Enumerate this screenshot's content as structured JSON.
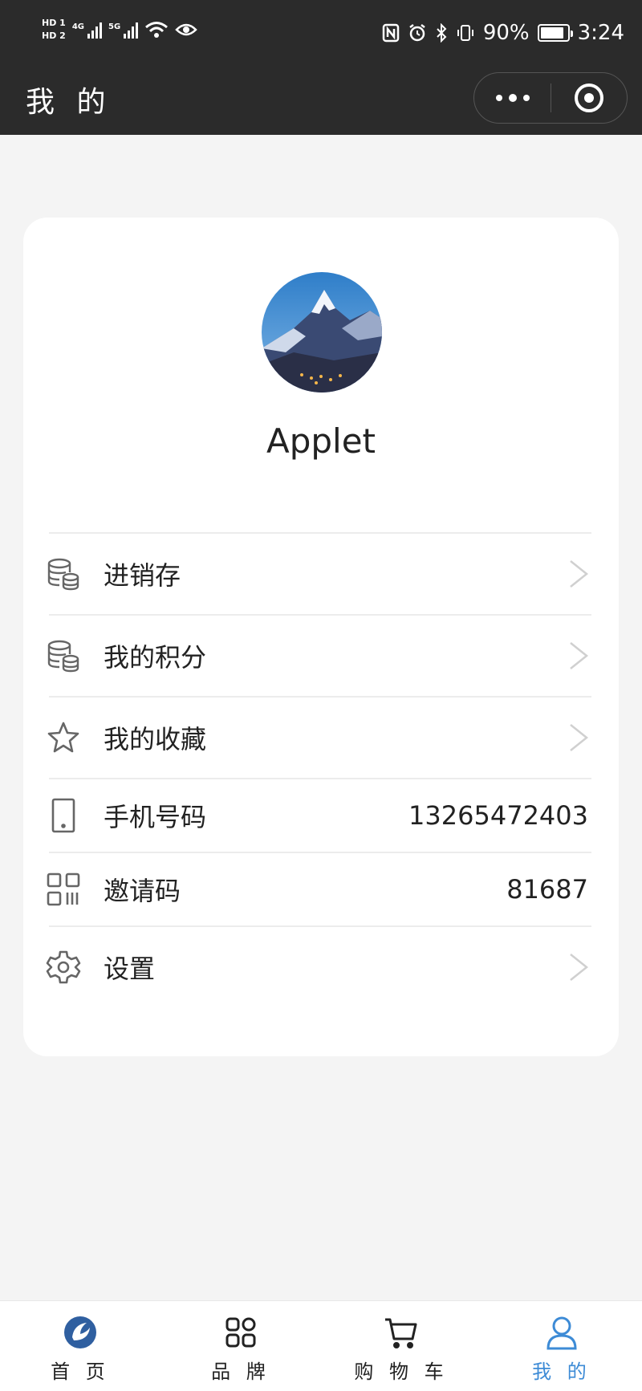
{
  "status_bar": {
    "hd1": "HD 1",
    "hd2": "HD 2",
    "net1": "4G",
    "net2": "5G",
    "battery_text": "90%",
    "battery_level": 0.9,
    "time": "3:24"
  },
  "header": {
    "title": "我 的",
    "more_icon": "more-dots-icon",
    "close_icon": "target-close-icon"
  },
  "profile": {
    "avatar": "mountain-avatar",
    "username": "Applet"
  },
  "menu": {
    "items": [
      {
        "label": "进销存",
        "icon": "database-icon"
      },
      {
        "label": "我的积分",
        "icon": "database-icon"
      },
      {
        "label": "我的收藏",
        "icon": "star-icon"
      },
      {
        "label": "手机号码",
        "icon": "phone-icon",
        "value": "13265472403"
      },
      {
        "label": "邀请码",
        "icon": "qrcode-icon",
        "value": "81687"
      },
      {
        "label": "设置",
        "icon": "gear-icon"
      }
    ]
  },
  "tabbar": {
    "items": [
      {
        "label": "首 页",
        "icon": "home-logo-icon"
      },
      {
        "label": "品 牌",
        "icon": "grid-icon"
      },
      {
        "label": "购 物 车",
        "icon": "cart-icon"
      },
      {
        "label": "我 的",
        "icon": "user-icon",
        "active": true
      }
    ]
  },
  "colors": {
    "header_bg": "#2b2b2b",
    "page_bg": "#f4f4f4",
    "accent": "#3d8bd6"
  }
}
